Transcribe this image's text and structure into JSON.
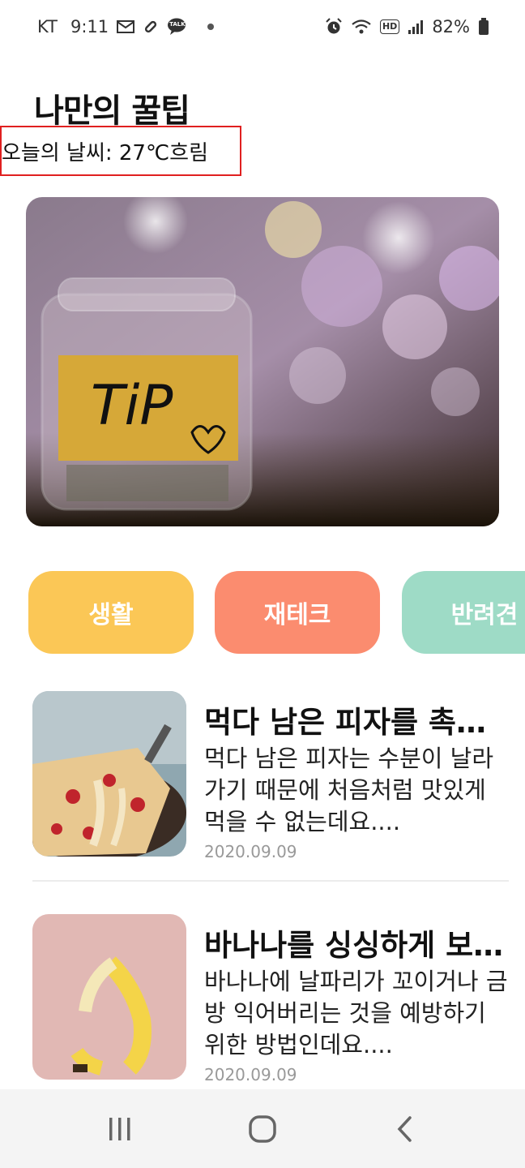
{
  "status_bar": {
    "carrier": "KT",
    "time": "9:11",
    "battery": "82%",
    "icons_left": [
      "mail-icon",
      "link-icon",
      "talk-icon"
    ],
    "talk_label": "TALK",
    "icons_right": [
      "alarm-icon",
      "wifi-icon",
      "hd-icon",
      "signal-icon",
      "battery-icon"
    ],
    "hd_label": "HD"
  },
  "header": {
    "title": "나만의 꿀팁",
    "weather": "오늘의 날씨: 27℃흐림"
  },
  "hero": {
    "image": "tip-jar-image",
    "label": "TiP"
  },
  "categories": [
    {
      "label": "생활",
      "color": "#fbc756"
    },
    {
      "label": "재테크",
      "color": "#fb8c6f"
    },
    {
      "label": "반려견",
      "color": "#9edbc6"
    }
  ],
  "articles": [
    {
      "title": "먹다 남은 피자를 촉촉하게",
      "description": "먹다 남은 피자는 수분이 날라가기 때문에 처음처럼 맛있게 먹을 수 없는데요....",
      "date": "2020.09.09",
      "thumbnail": "pizza-image"
    },
    {
      "title": "바나나를 싱싱하게 보관하기",
      "description": "바나나에 날파리가 꼬이거나 금방 익어버리는 것을 예방하기 위한 방법인데요....",
      "date": "2020.09.09",
      "thumbnail": "banana-image"
    }
  ],
  "nav_bar": {
    "items": [
      "recent-apps-icon",
      "home-icon",
      "back-icon"
    ]
  }
}
